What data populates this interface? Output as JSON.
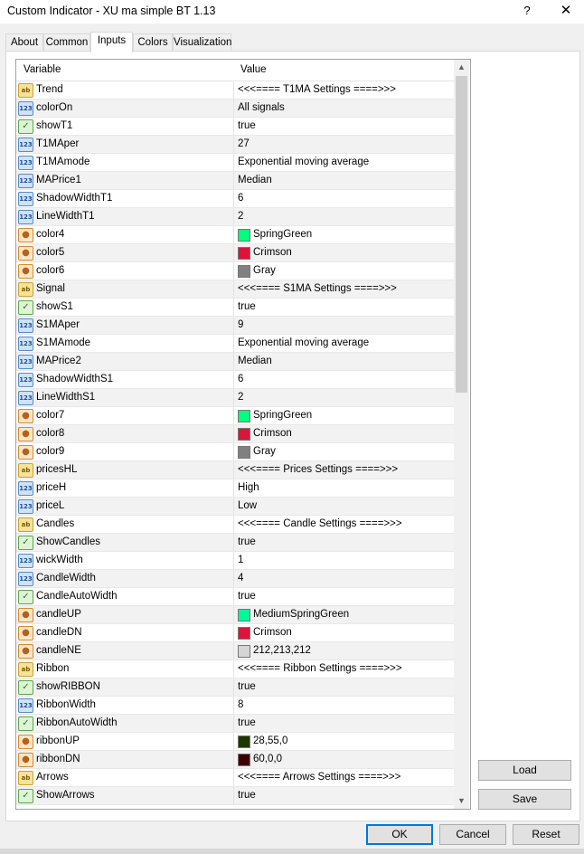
{
  "window": {
    "title": "Custom Indicator - XU ma simple BT 1.13",
    "help": "?",
    "close": "✕"
  },
  "tabs": [
    "About",
    "Common",
    "Inputs",
    "Colors",
    "Visualization"
  ],
  "grid": {
    "header": {
      "variable": "Variable",
      "value": "Value"
    },
    "rows": [
      {
        "icon": "ab",
        "name": "Trend",
        "value": "<<<==== T1MA Settings ====>>>"
      },
      {
        "icon": "123",
        "name": "colorOn",
        "value": "All signals"
      },
      {
        "icon": "bool",
        "name": "showT1",
        "value": "true"
      },
      {
        "icon": "123",
        "name": "T1MAper",
        "value": "27"
      },
      {
        "icon": "123",
        "name": "T1MAmode",
        "value": "Exponential moving average"
      },
      {
        "icon": "123",
        "name": "MAPrice1",
        "value": "Median"
      },
      {
        "icon": "123",
        "name": "ShadowWidthT1",
        "value": "6"
      },
      {
        "icon": "123",
        "name": "LineWidthT1",
        "value": "2"
      },
      {
        "icon": "color",
        "name": "color4",
        "value": "SpringGreen",
        "swatch": "#00ff7f"
      },
      {
        "icon": "color",
        "name": "color5",
        "value": "Crimson",
        "swatch": "#dc143c"
      },
      {
        "icon": "color",
        "name": "color6",
        "value": "Gray",
        "swatch": "#808080"
      },
      {
        "icon": "ab",
        "name": "Signal",
        "value": "<<<==== S1MA Settings ====>>>"
      },
      {
        "icon": "bool",
        "name": "showS1",
        "value": "true"
      },
      {
        "icon": "123",
        "name": "S1MAper",
        "value": "9"
      },
      {
        "icon": "123",
        "name": "S1MAmode",
        "value": "Exponential moving average"
      },
      {
        "icon": "123",
        "name": "MAPrice2",
        "value": "Median"
      },
      {
        "icon": "123",
        "name": "ShadowWidthS1",
        "value": "6"
      },
      {
        "icon": "123",
        "name": "LineWidthS1",
        "value": "2"
      },
      {
        "icon": "color",
        "name": "color7",
        "value": "SpringGreen",
        "swatch": "#00ff7f"
      },
      {
        "icon": "color",
        "name": "color8",
        "value": "Crimson",
        "swatch": "#dc143c"
      },
      {
        "icon": "color",
        "name": "color9",
        "value": "Gray",
        "swatch": "#808080"
      },
      {
        "icon": "ab",
        "name": "pricesHL",
        "value": "<<<==== Prices Settings ====>>>"
      },
      {
        "icon": "123",
        "name": "priceH",
        "value": "High"
      },
      {
        "icon": "123",
        "name": "priceL",
        "value": "Low"
      },
      {
        "icon": "ab",
        "name": "Candles",
        "value": "<<<==== Candle Settings ====>>>"
      },
      {
        "icon": "bool",
        "name": "ShowCandles",
        "value": "true"
      },
      {
        "icon": "123",
        "name": "wickWidth",
        "value": "1"
      },
      {
        "icon": "123",
        "name": "CandleWidth",
        "value": "4"
      },
      {
        "icon": "bool",
        "name": "CandleAutoWidth",
        "value": "true"
      },
      {
        "icon": "color",
        "name": "candleUP",
        "value": "MediumSpringGreen",
        "swatch": "#00fa9a"
      },
      {
        "icon": "color",
        "name": "candleDN",
        "value": "Crimson",
        "swatch": "#dc143c"
      },
      {
        "icon": "color",
        "name": "candleNE",
        "value": "212,213,212",
        "swatch": "#d4d5d4"
      },
      {
        "icon": "ab",
        "name": "Ribbon",
        "value": "<<<==== Ribbon Settings ====>>>"
      },
      {
        "icon": "bool",
        "name": "showRIBBON",
        "value": "true"
      },
      {
        "icon": "123",
        "name": "RibbonWidth",
        "value": "8"
      },
      {
        "icon": "bool",
        "name": "RibbonAutoWidth",
        "value": "true"
      },
      {
        "icon": "color",
        "name": "ribbonUP",
        "value": "28,55,0",
        "swatch": "#1c3700"
      },
      {
        "icon": "color",
        "name": "ribbonDN",
        "value": "60,0,0",
        "swatch": "#3c0000"
      },
      {
        "icon": "ab",
        "name": "Arrows",
        "value": "<<<==== Arrows Settings ====>>>"
      },
      {
        "icon": "bool",
        "name": "ShowArrows",
        "value": "true"
      }
    ]
  },
  "side_buttons": {
    "load": "Load",
    "save": "Save"
  },
  "footer_buttons": {
    "ok": "OK",
    "cancel": "Cancel",
    "reset": "Reset"
  }
}
